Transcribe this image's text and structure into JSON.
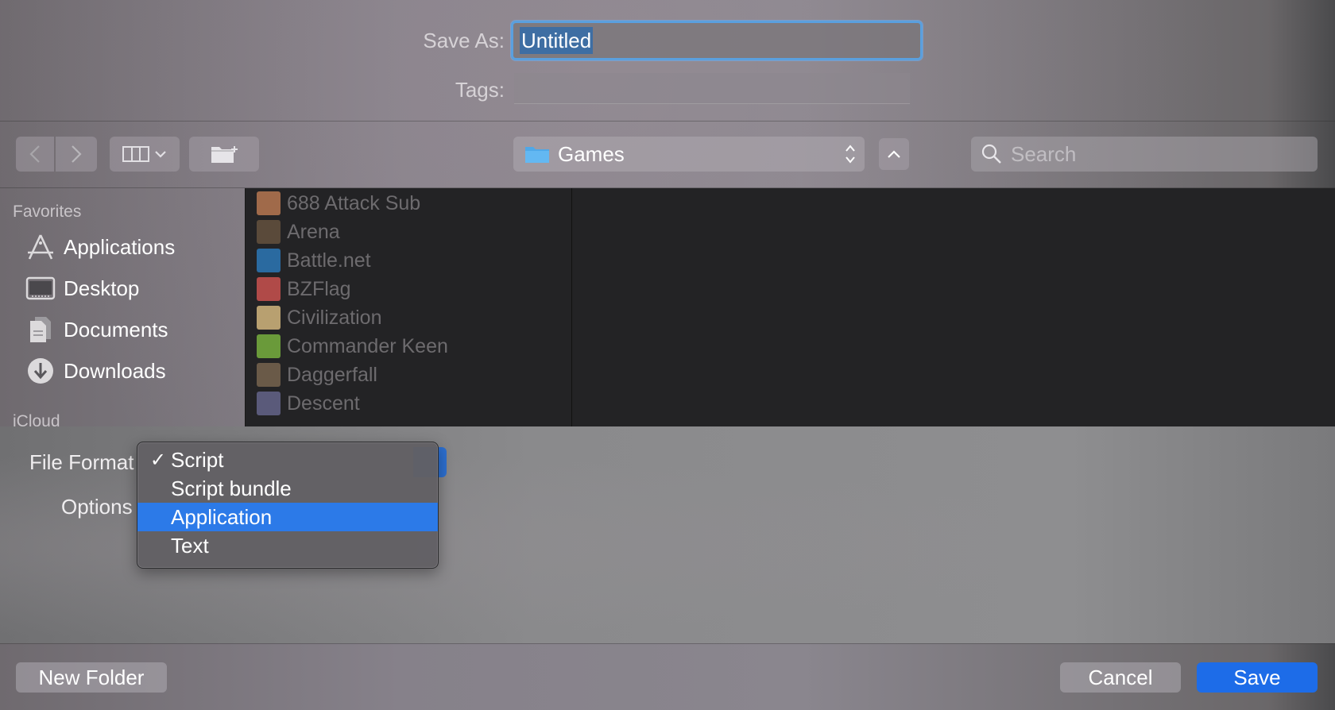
{
  "header": {
    "save_as_label": "Save As:",
    "save_as_value": "Untitled",
    "tags_label": "Tags:"
  },
  "toolbar": {
    "location": "Games",
    "search_placeholder": "Search"
  },
  "sidebar": {
    "favorites_heading": "Favorites",
    "items": [
      {
        "label": "Applications",
        "icon": "applications-icon"
      },
      {
        "label": "Desktop",
        "icon": "desktop-icon"
      },
      {
        "label": "Documents",
        "icon": "documents-icon"
      },
      {
        "label": "Downloads",
        "icon": "downloads-icon"
      }
    ],
    "icloud_heading": "iCloud"
  },
  "files": [
    {
      "name": "688 Attack Sub",
      "color": "#a06a4a"
    },
    {
      "name": "Arena",
      "color": "#5a4a3a"
    },
    {
      "name": "Battle.net",
      "color": "#2a6aa0"
    },
    {
      "name": "BZFlag",
      "color": "#b04a48"
    },
    {
      "name": "Civilization",
      "color": "#b8a070"
    },
    {
      "name": "Commander Keen",
      "color": "#6a9a3a"
    },
    {
      "name": "Daggerfall",
      "color": "#6a5a48"
    },
    {
      "name": "Descent",
      "color": "#5a5a7a"
    }
  ],
  "options": {
    "file_format_label": "File Format",
    "options_label": "Options"
  },
  "menu": {
    "items": [
      {
        "label": "Script",
        "checked": true,
        "selected": false
      },
      {
        "label": "Script bundle",
        "checked": false,
        "selected": false
      },
      {
        "label": "Application",
        "checked": false,
        "selected": true
      },
      {
        "label": "Text",
        "checked": false,
        "selected": false
      }
    ],
    "checkmark": "✓"
  },
  "footer": {
    "new_folder_label": "New Folder",
    "cancel_label": "Cancel",
    "save_label": "Save"
  },
  "colors": {
    "accent": "#1d6ce8",
    "menu_highlight": "#2c7ae8"
  }
}
